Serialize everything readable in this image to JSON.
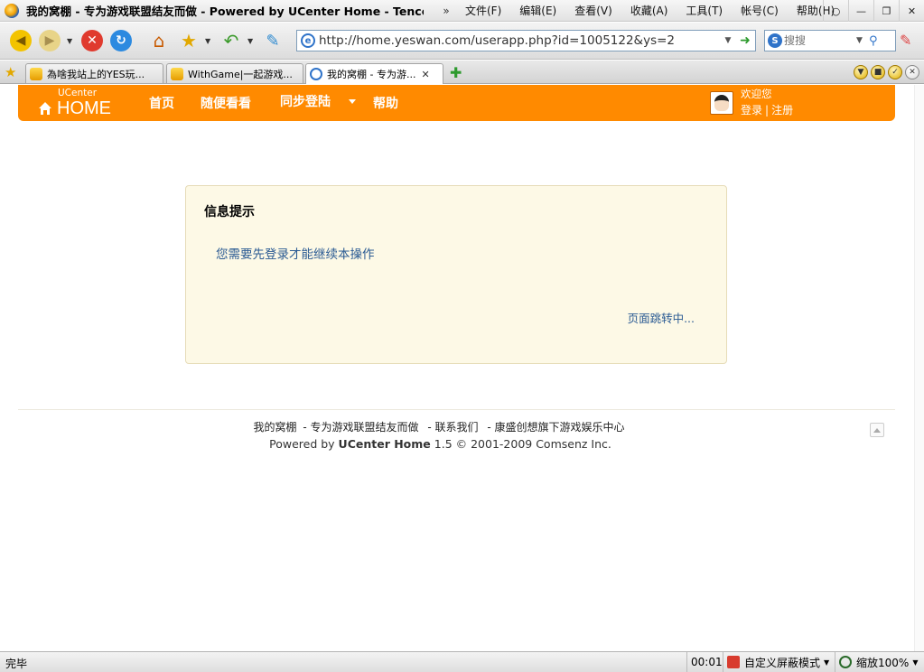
{
  "browser": {
    "window_title": "我的窝棚 - 专为游戏联盟结友而做 - Powered by UCenter Home - Tencen...",
    "menu_chevron": "»",
    "menu": [
      "文件(F)",
      "编辑(E)",
      "查看(V)",
      "收藏(A)",
      "工具(T)",
      "帐号(C)",
      "帮助(H)"
    ],
    "address_url": "http://home.yeswan.com/userapp.php?id=1005122&ys=2",
    "search_placeholder": "搜搜",
    "tabs": [
      {
        "label": "為啥我站上的YES玩...",
        "active": false
      },
      {
        "label": "WithGame|一起游戏...",
        "active": false
      },
      {
        "label": "我的窝棚 - 专为游...",
        "active": true
      }
    ],
    "status_text": "完毕",
    "status_time": "00:01",
    "status_block_mode": "自定义屏蔽模式",
    "status_zoom": "缩放100%",
    "accent_color": "#ff8a00"
  },
  "site": {
    "logo_small": "UCenter",
    "logo_main": "HOME",
    "nav": [
      "首页",
      "随便看看",
      "同步登陆",
      "帮助"
    ],
    "welcome": "欢迎您",
    "login": "登录",
    "separator": "|",
    "register": "注册"
  },
  "message": {
    "title": "信息提示",
    "text": "您需要先登录才能继续本操作",
    "redirect": "页面跳转中..."
  },
  "footer": {
    "links": [
      "我的窝棚",
      "- 专为游戏联盟结友而做",
      "- 联系我们",
      "- 康盛创想旗下游戏娱乐中心"
    ],
    "powered_prefix": "Powered by",
    "powered_product": "UCenter Home",
    "powered_suffix": "1.5 © 2001-2009 Comsenz Inc."
  }
}
